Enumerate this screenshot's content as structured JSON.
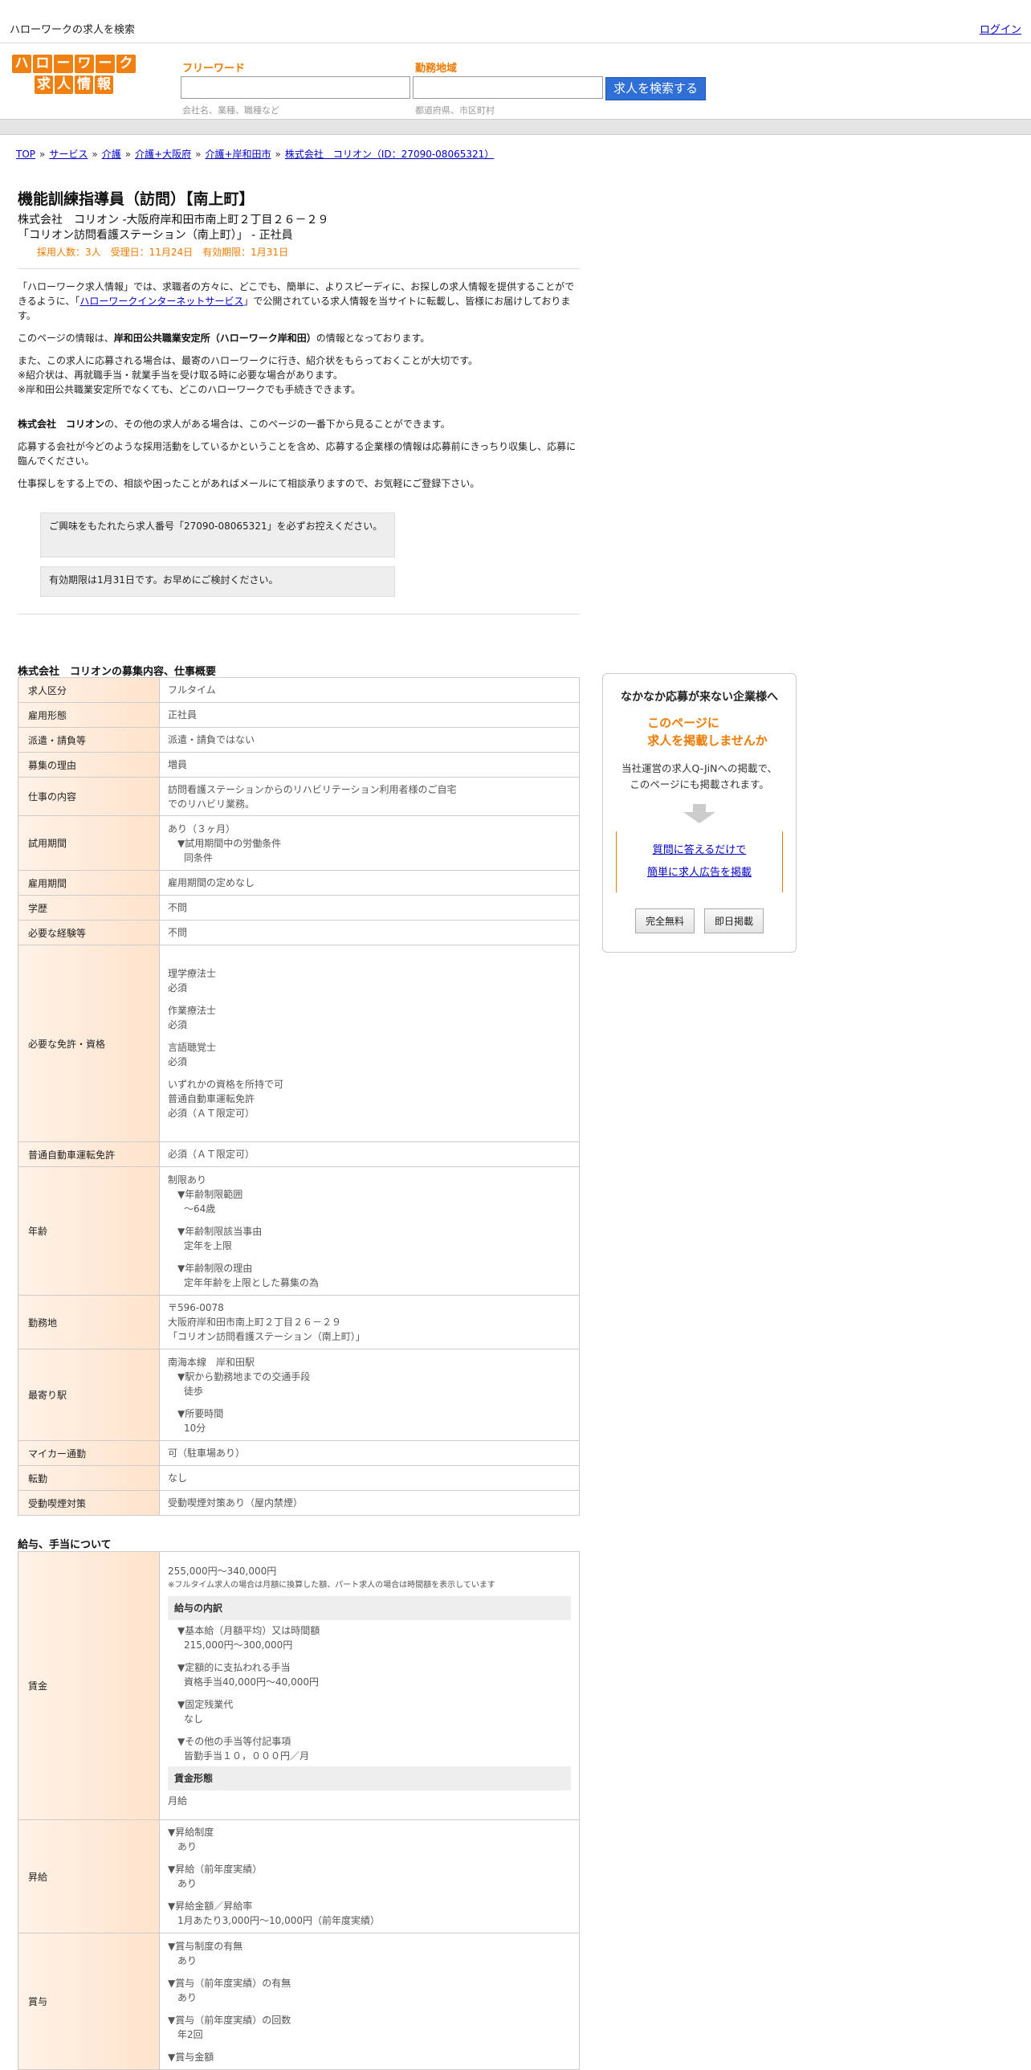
{
  "topbar": {
    "title": "ハローワークの求人を検索",
    "login": "ログイン"
  },
  "logo": {
    "row1": [
      "ハ",
      "ロ",
      "ー",
      "ワ",
      "ー",
      "ク"
    ],
    "row2": [
      "求",
      "人",
      "情",
      "報"
    ]
  },
  "search": {
    "freeword_label": "フリーワード",
    "freeword_hint": "会社名、業種、職種など",
    "area_label": "勤務地域",
    "area_hint": "都道府県、市区町村",
    "button": "求人を検索する"
  },
  "breadcrumb": [
    "TOP",
    "サービス",
    "介護",
    "介護+大阪府",
    "介護+岸和田市",
    "株式会社　コリオン（ID：27090-08065321）"
  ],
  "job": {
    "title": "機能訓練指導員（訪問）【南上町】",
    "company_line": "株式会社　コリオン -大阪府岸和田市南上町２丁目２６－２９",
    "office_line": "「コリオン訪問看護ステーション（南上町）」 - 正社員",
    "meta": "採用人数：3人　受理日：11月24日　有効期限：1月31日"
  },
  "intro": {
    "p1_a": "「ハローワーク求人情報」では、求職者の方々に、どこでも、簡単に、よりスピーディに、お探しの求人情報を提供することができるように、「",
    "p1_link": "ハローワークインターネットサービス",
    "p1_b": "」で公開されている求人情報を当サイトに転載し、皆様にお届けしております。",
    "p2_a": "このページの情報は、",
    "p2_bold": "岸和田公共職業安定所（ハローワーク岸和田）",
    "p2_b": "の情報となっております。",
    "p3": [
      "また、この求人に応募される場合は、最寄のハローワークに行き、紹介状をもらっておくことが大切です。",
      "※紹介状は、再就職手当・就業手当を受け取る時に必要な場合があります。",
      "※岸和田公共職業安定所でなくても、どこのハローワークでも手続きできます。"
    ],
    "p4_bold": "株式会社　コリオン",
    "p4": "の、その他の求人がある場合は、このページの一番下から見ることができます。",
    "p5": "応募する会社が今どのような採用活動をしているかということを含め、応募する企業様の情報は応募前にきっちり収集し、応募に臨んでください。",
    "p6": "仕事探しをする上での、相談や困ったことがあればメールにて相談承りますので、お気軽にご登録下さい。",
    "note1": "ご興味をもたれたら求人番号「27090-08065321」を必ずお控えください。",
    "note2": "有効期限は1月31日です。お早めにご検討ください。"
  },
  "section1": "株式会社　コリオンの募集内容、仕事概要",
  "rows": [
    {
      "k": "求人区分",
      "v": [
        "フルタイム"
      ]
    },
    {
      "k": "雇用形態",
      "v": [
        "正社員"
      ]
    },
    {
      "k": "派遣・請負等",
      "v": [
        "派遣・請負ではない"
      ]
    },
    {
      "k": "募集の理由",
      "v": [
        "増員"
      ]
    },
    {
      "k": "仕事の内容",
      "v": [
        "訪問看護ステーションからのリハビリテーション利用者様のご自宅",
        "でのリハビリ業務。"
      ]
    },
    {
      "k": "試用期間",
      "v": [
        "あり（３ヶ月）",
        "▼試用期間中の労働条件",
        "同条件"
      ]
    },
    {
      "k": "雇用期間",
      "v": [
        "雇用期間の定めなし"
      ]
    },
    {
      "k": "学歴",
      "v": [
        "不問"
      ]
    },
    {
      "k": "必要な経験等",
      "v": [
        "不問"
      ]
    },
    {
      "k": "必要な免許・資格",
      "v": [
        "理学療法士",
        "必須",
        "作業療法士",
        "必須",
        "言語聴覚士",
        "必須",
        "いずれかの資格を所持で可",
        "普通自動車運転免許",
        "必須（ＡＴ限定可）"
      ]
    },
    {
      "k": "普通自動車運転免許",
      "v": [
        "必須（ＡＴ限定可）"
      ]
    },
    {
      "k": "年齢",
      "v": [
        "制限あり",
        "▼年齢制限範囲",
        "〜64歳",
        "▼年齢制限該当事由",
        "定年を上限",
        "▼年齢制限の理由",
        "定年年齢を上限とした募集の為"
      ]
    },
    {
      "k": "勤務地",
      "v": [
        "〒596-0078",
        "大阪府岸和田市南上町２丁目２６－２９",
        "「コリオン訪問看護ステーション（南上町）」"
      ]
    },
    {
      "k": "最寄り駅",
      "v": [
        "南海本線　岸和田駅",
        "▼駅から勤務地までの交通手段",
        "徒歩",
        "▼所要時間",
        "10分"
      ]
    },
    {
      "k": "マイカー通勤",
      "v": [
        "可（駐車場あり）"
      ]
    },
    {
      "k": "転勤",
      "v": [
        "なし"
      ]
    },
    {
      "k": "受動喫煙対策",
      "v": [
        "受動喫煙対策あり（屋内禁煙）"
      ]
    }
  ],
  "section2": "給与、手当について",
  "wage": {
    "k": "賃金",
    "range": "255,000円〜340,000円",
    "note": "※フルタイム求人の場合は月額に換算した額、パート求人の場合は時間額を表示しています",
    "breakdown_title": "給与の内訳",
    "items": [
      "▼基本給（月額平均）又は時間額",
      "215,000円〜300,000円",
      "▼定額的に支払われる手当",
      "資格手当40,000円〜40,000円",
      "▼固定残業代",
      "なし",
      "▼その他の手当等付記事項",
      "皆勤手当１０，０００円／月"
    ],
    "form_title": "賃金形態",
    "form": "月給"
  },
  "raise": {
    "k": "昇給",
    "v": [
      "▼昇給制度",
      "あり",
      "▼昇給（前年度実績）",
      "あり",
      "▼昇給金額／昇給率",
      "1月あたり3,000円〜10,000円（前年度実績）"
    ]
  },
  "bonus": {
    "k": "賞与",
    "v": [
      "▼賞与制度の有無",
      "あり",
      "▼賞与（前年度実績）の有無",
      "あり",
      "▼賞与（前年度実績）の回数",
      "年2回",
      "▼賞与金額"
    ]
  },
  "side": {
    "heading": "なかなか応募が来ない企業様へ",
    "orange1": "このページに",
    "orange2": "求人を掲載しませんか",
    "desc1": "当社運営の求人Q-JiNへの掲載で、",
    "desc2": "このページにも掲載されます。",
    "link1": "質問に答えるだけで",
    "link2": "簡単に求人広告を掲載",
    "btn1": "完全無料",
    "btn2": "即日掲載"
  }
}
